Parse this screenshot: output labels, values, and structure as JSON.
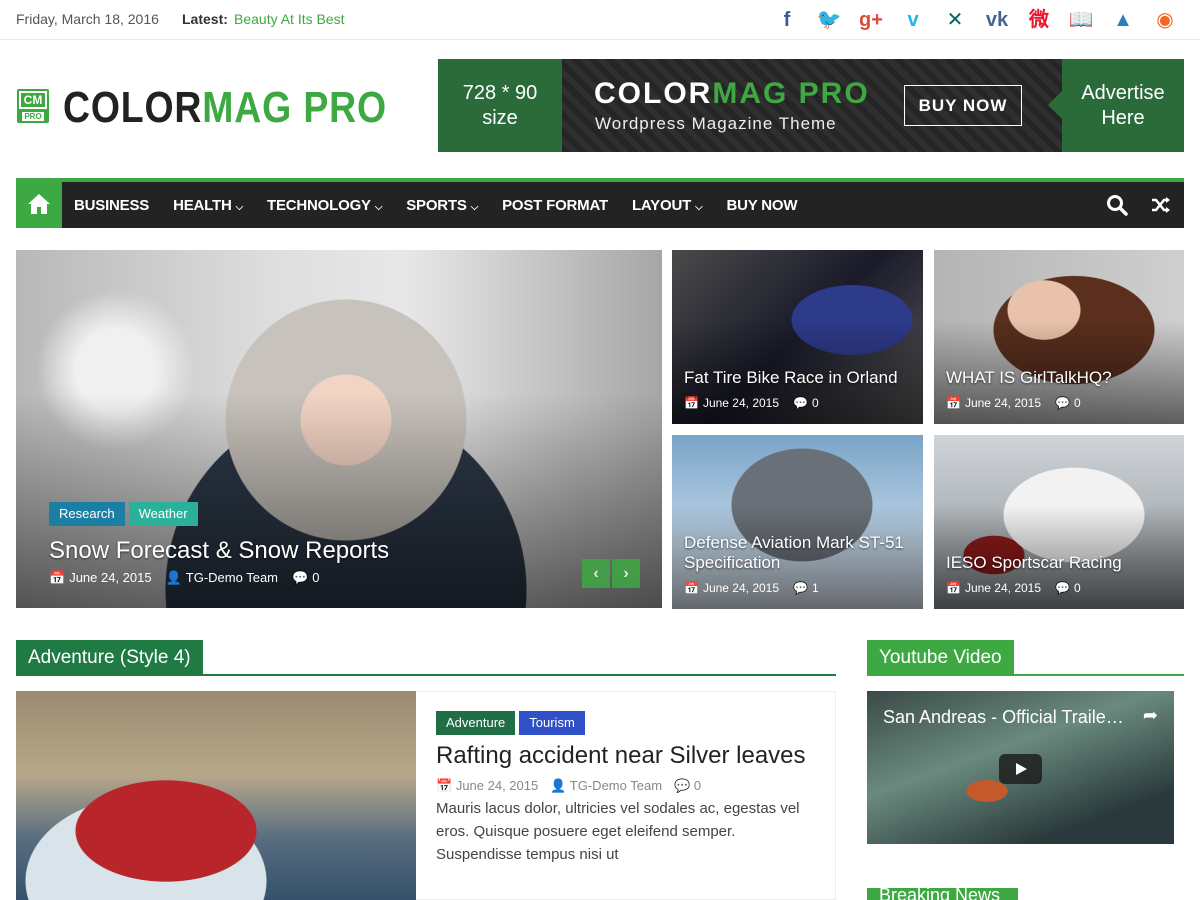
{
  "topbar": {
    "date": "Friday, March 18, 2016",
    "latest_label": "Latest:",
    "latest_link": "Beauty At Its Best",
    "social": [
      {
        "icon": "facebook-icon",
        "glyph": "f",
        "color": "#3b5998"
      },
      {
        "icon": "twitter-icon",
        "glyph": "🐦",
        "color": "#1da1f2"
      },
      {
        "icon": "google-plus-icon",
        "glyph": "g+",
        "color": "#dd4b39"
      },
      {
        "icon": "vimeo-icon",
        "glyph": "v",
        "color": "#1ab7ea"
      },
      {
        "icon": "xing-icon",
        "glyph": "✕",
        "color": "#026466"
      },
      {
        "icon": "vk-icon",
        "glyph": "vk",
        "color": "#45668e"
      },
      {
        "icon": "weibo-icon",
        "glyph": "微",
        "color": "#e6162d"
      },
      {
        "icon": "book-icon",
        "glyph": "📖",
        "color": "#222222"
      },
      {
        "icon": "tripadvisor-icon",
        "glyph": "▲",
        "color": "#2a7fc1"
      },
      {
        "icon": "rss-icon",
        "glyph": "◉",
        "color": "#f26522"
      }
    ]
  },
  "header": {
    "logo_part1": "COLOR",
    "logo_part2": "MAG PRO",
    "logo_badge_top": "CM",
    "logo_badge_bottom": "PRO"
  },
  "ad": {
    "size_line1": "728 * 90",
    "size_line2": "size",
    "title_part1": "COLOR",
    "title_part2": "MAG PRO",
    "subtitle": "Wordpress Magazine Theme",
    "buy": "BUY NOW",
    "right_line1": "Advertise",
    "right_line2": "Here"
  },
  "nav": {
    "items": [
      {
        "label": "BUSINESS",
        "dropdown": ""
      },
      {
        "label": "HEALTH",
        "dropdown": "⌄"
      },
      {
        "label": "TECHNOLOGY",
        "dropdown": "⌄"
      },
      {
        "label": "SPORTS",
        "dropdown": "⌄"
      },
      {
        "label": "POST FORMAT",
        "dropdown": ""
      },
      {
        "label": "LAYOUT",
        "dropdown": "⌄"
      },
      {
        "label": "BUY NOW",
        "dropdown": ""
      }
    ]
  },
  "hero": {
    "main": {
      "tags": [
        {
          "label": "Research",
          "color": "#1a7fa3"
        },
        {
          "label": "Weather",
          "color": "#2bb09a"
        }
      ],
      "title": "Snow Forecast & Snow Reports",
      "date": "June 24, 2015",
      "author": "TG-Demo Team",
      "comments": "0"
    },
    "cards": [
      {
        "title": "Fat Tire Bike Race in Orland",
        "date": "June 24, 2015",
        "comments": "0"
      },
      {
        "title": "WHAT IS GirlTalkHQ?",
        "date": "June 24, 2015",
        "comments": "0"
      },
      {
        "title": "Defense Aviation Mark ST-51 Specification",
        "date": "June 24, 2015",
        "comments": "1"
      },
      {
        "title": "IESO Sportscar Racing",
        "date": "June 24, 2015",
        "comments": "0"
      }
    ]
  },
  "adventure": {
    "heading": "Adventure (Style 4)",
    "tags": [
      {
        "label": "Adventure",
        "color": "#1f6e45"
      },
      {
        "label": "Tourism",
        "color": "#3050c8"
      }
    ],
    "title": "Rafting accident near Silver leaves",
    "date": "June 24, 2015",
    "author": "TG-Demo Team",
    "comments": "0",
    "excerpt": "Mauris lacus dolor, ultricies vel sodales ac, egestas vel eros. Quisque posuere eget eleifend semper. Suspendisse tempus nisi ut"
  },
  "sidebar": {
    "youtube_heading": "Youtube Video",
    "video_title": "San Andreas - Official Traile…",
    "breaking_heading": "Breaking News"
  },
  "colors": {
    "accent": "#3ea843",
    "nav_bg": "#232323",
    "heading_dark_green": "#207a43"
  }
}
